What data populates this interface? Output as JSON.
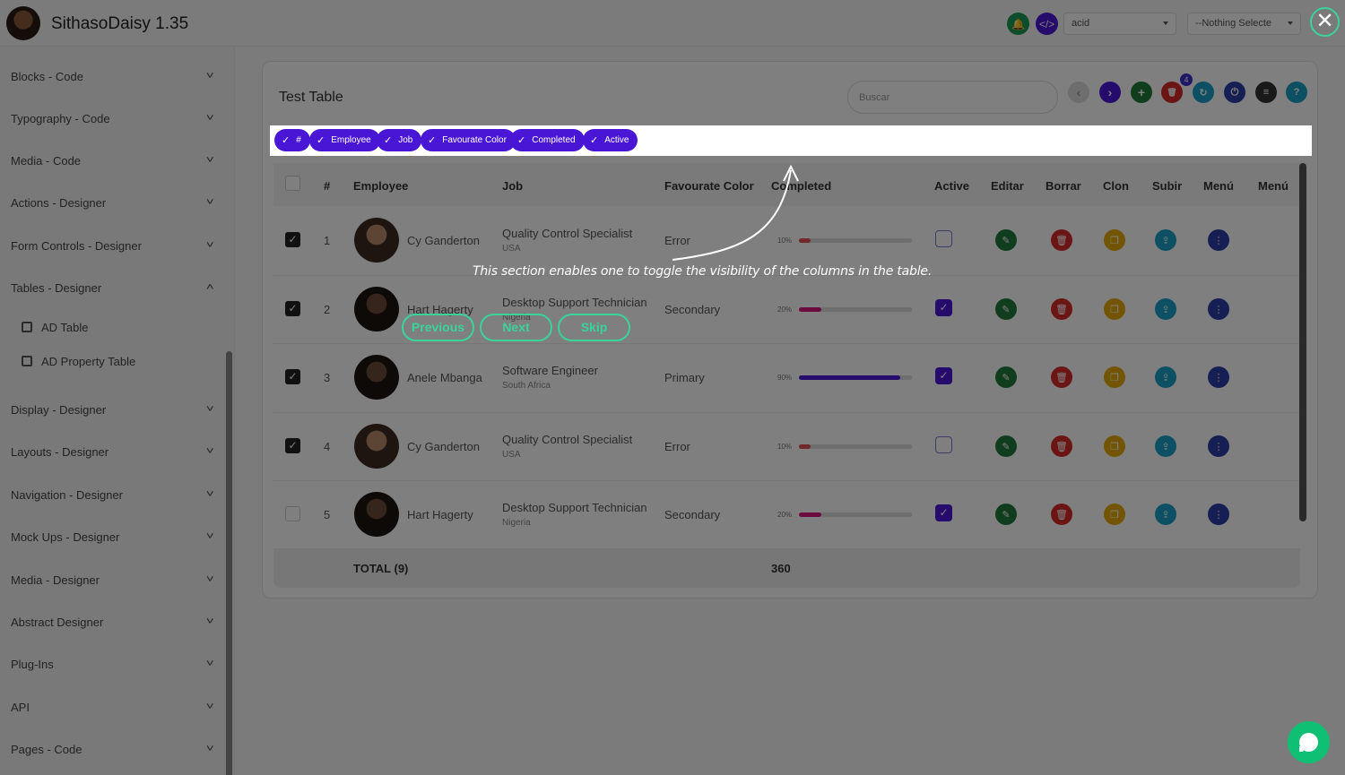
{
  "app": {
    "title": "SithasoDaisy 1.35"
  },
  "header": {
    "theme_select": "acid",
    "nothing_select": "--Nothing Selecte",
    "close_glyph": "✕"
  },
  "sidebar": {
    "items": [
      {
        "label": "Blocks - Code"
      },
      {
        "label": "Typography - Code"
      },
      {
        "label": "Media - Code"
      },
      {
        "label": "Actions - Designer"
      },
      {
        "label": "Form Controls - Designer"
      },
      {
        "label": "Tables - Designer"
      },
      {
        "label": "Display - Designer"
      },
      {
        "label": "Layouts - Designer"
      },
      {
        "label": "Navigation - Designer"
      },
      {
        "label": "Mock Ups - Designer"
      },
      {
        "label": "Media - Designer"
      },
      {
        "label": "Abstract Designer"
      },
      {
        "label": "Plug-Ins"
      },
      {
        "label": "API"
      },
      {
        "label": "Pages - Code"
      }
    ],
    "sub_items": [
      {
        "label": "AD Table"
      },
      {
        "label": "AD Property Table"
      }
    ]
  },
  "card": {
    "title": "Test Table",
    "search_placeholder": "Buscar",
    "badge_count": "4",
    "toolbar": {
      "prev": "‹",
      "next": "›",
      "add": "+",
      "delete": "🗑",
      "refresh": "↻",
      "power": "⏻",
      "menu": "≡",
      "help": "?"
    }
  },
  "chips": [
    {
      "label": "#"
    },
    {
      "label": "Employee"
    },
    {
      "label": "Job"
    },
    {
      "label": "Favourate Color"
    },
    {
      "label": "Completed"
    },
    {
      "label": "Active"
    }
  ],
  "table": {
    "columns": [
      "#",
      "Employee",
      "Job",
      "Favourate Color",
      "Completed",
      "Active",
      "Editar",
      "Borrar",
      "Clon",
      "Subir",
      "Menú",
      "Menú"
    ],
    "rows": [
      {
        "num": "1",
        "employee": "Cy Ganderton",
        "job": "Quality Control Specialist",
        "country": "USA",
        "color": "Error",
        "pct_label": "10%",
        "pct": 10,
        "bar_color": "#e0505a",
        "active": false,
        "checked": true
      },
      {
        "num": "2",
        "employee": "Hart Hagerty",
        "job": "Desktop Support Technician",
        "country": "Nigeria",
        "color": "Secondary",
        "pct_label": "20%",
        "pct": 20,
        "bar_color": "#d9197d",
        "active": true,
        "checked": true
      },
      {
        "num": "3",
        "employee": "Anele Mbanga",
        "job": "Software Engineer",
        "country": "South Africa",
        "color": "Primary",
        "pct_label": "90%",
        "pct": 90,
        "bar_color": "#4a16d6",
        "active": true,
        "checked": true
      },
      {
        "num": "4",
        "employee": "Cy Ganderton",
        "job": "Quality Control Specialist",
        "country": "USA",
        "color": "Error",
        "pct_label": "10%",
        "pct": 10,
        "bar_color": "#e0505a",
        "active": false,
        "checked": true
      },
      {
        "num": "5",
        "employee": "Hart Hagerty",
        "job": "Desktop Support Technician",
        "country": "Nigeria",
        "color": "Secondary",
        "pct_label": "20%",
        "pct": 20,
        "bar_color": "#d9197d",
        "active": true,
        "checked": false
      }
    ],
    "footer": {
      "total_label": "TOTAL (9)",
      "total_value": "360"
    }
  },
  "tour": {
    "text": "This section enables one to toggle the visibility of the columns in the table.",
    "previous": "Previous",
    "next": "Next",
    "skip": "Skip"
  },
  "colors": {
    "primary": "#4a16d6",
    "edit": "#1f7a3c",
    "delete": "#d62b2b",
    "clone": "#e6a800",
    "upload": "#1aa0c8",
    "menu": "#2d3fa8",
    "tour_accent": "#3ad39a"
  }
}
